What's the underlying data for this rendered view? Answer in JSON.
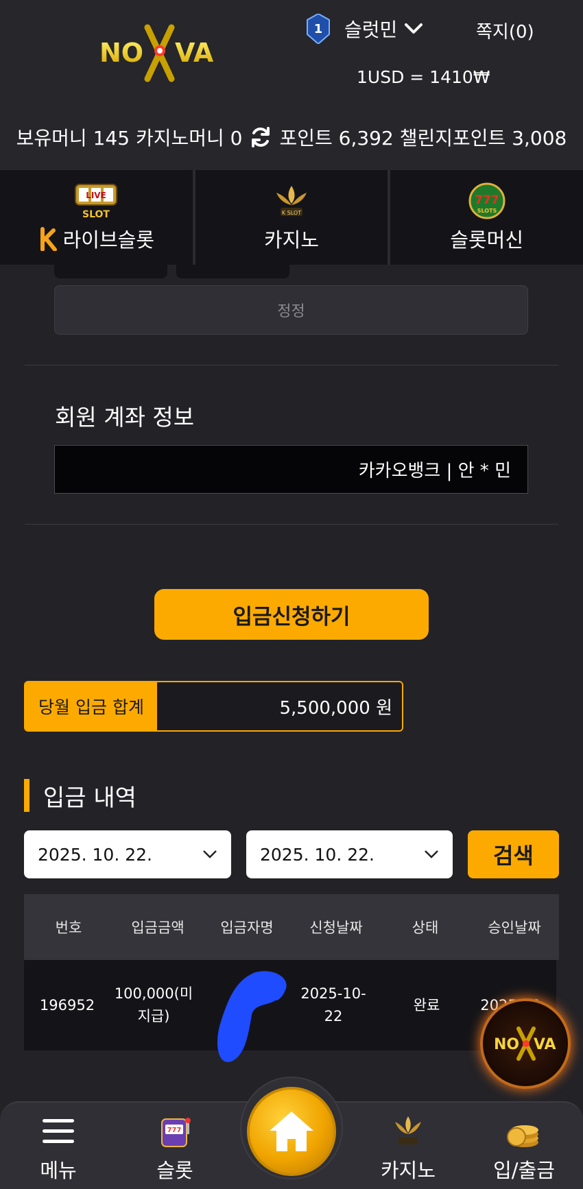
{
  "header": {
    "brand": "NOVA",
    "level": "1",
    "username": "슬럿민",
    "messages": "쪽지(0)",
    "exchange_rate": "1USD = 1410₩"
  },
  "balances": {
    "text_left": "보유머니 145 카지노머니 0",
    "text_right": "포인트 6,392 챌린지포인트 3,008"
  },
  "categories": [
    {
      "label": "라이브슬롯",
      "icon": "live-slot-icon"
    },
    {
      "label": "카지노",
      "icon": "k-slot-icon"
    },
    {
      "label": "슬롯머신",
      "icon": "777-slots-icon"
    }
  ],
  "form": {
    "fix_button": "정정",
    "account_title": "회원 계좌 정보",
    "account_value": "카카오뱅크 | 안 * 민",
    "deposit_button": "입금신청하기"
  },
  "monthly_total": {
    "label": "당월 입금 합계",
    "value": "5,500,000 원"
  },
  "history": {
    "title": "입금 내역",
    "date_from": "2025. 10. 22.",
    "date_to": "2025. 10. 22.",
    "search_button": "검색",
    "columns": [
      "번호",
      "입금금액",
      "입금자명",
      "신청날짜",
      "상태",
      "승인날짜"
    ],
    "rows": [
      {
        "id": "196952",
        "amount": "100,000(미지급)",
        "depositor": "",
        "requested": "2025-10-22",
        "status": "완료",
        "approved": "2025-10-"
      }
    ]
  },
  "bottom_nav": {
    "menu": "메뉴",
    "slot": "슬롯",
    "casino": "카지노",
    "deposit_withdraw": "입/출금"
  },
  "colors": {
    "accent": "#fdaa00",
    "background": "#232227",
    "dark_panel": "#141418"
  }
}
